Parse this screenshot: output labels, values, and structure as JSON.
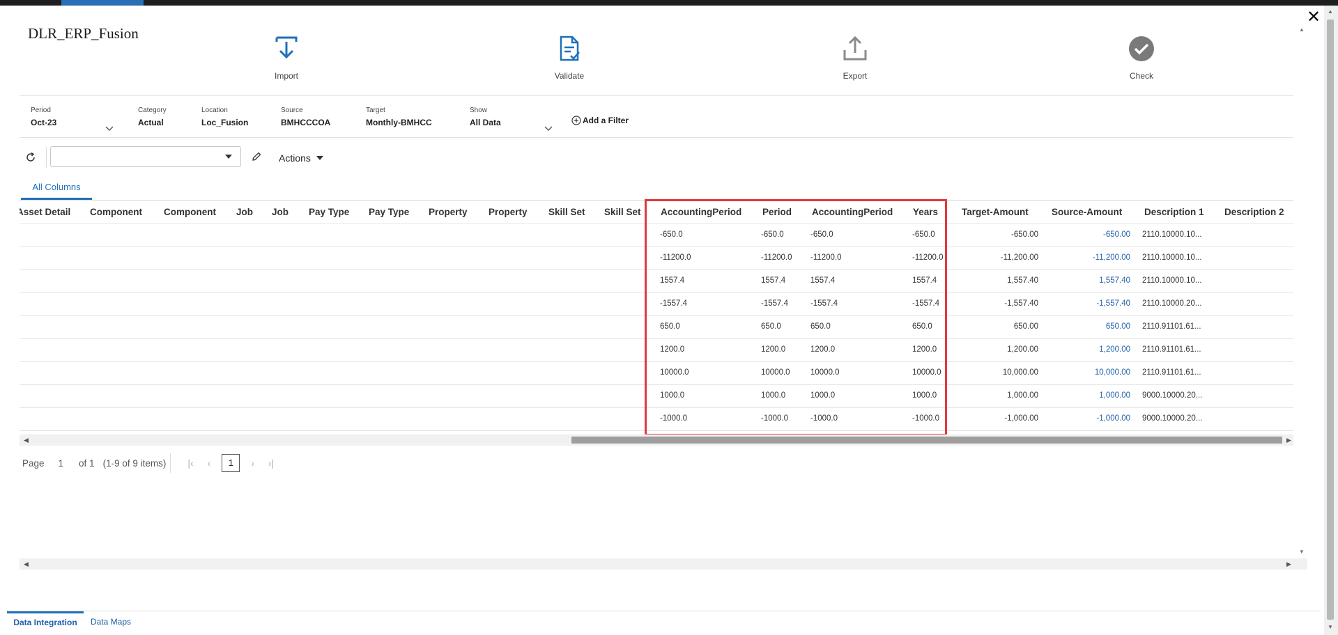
{
  "app": {
    "title": "DLR_ERP_Fusion"
  },
  "toolbar": {
    "import_label": "Import",
    "validate_label": "Validate",
    "export_label": "Export",
    "check_label": "Check"
  },
  "filters": {
    "period": {
      "label": "Period",
      "value": "Oct-23"
    },
    "category": {
      "label": "Category",
      "value": "Actual"
    },
    "location": {
      "label": "Location",
      "value": "Loc_Fusion"
    },
    "source": {
      "label": "Source",
      "value": "BMHCCCOA"
    },
    "target": {
      "label": "Target",
      "value": "Monthly-BMHCC"
    },
    "show": {
      "label": "Show",
      "value": "All Data"
    },
    "add_filter_label": "Add a Filter"
  },
  "grid_toolbar": {
    "view_value": "",
    "actions_label": "Actions"
  },
  "tabs": {
    "all_columns": "All Columns"
  },
  "columns": [
    "Asset Detail",
    "Component",
    "Component",
    "Job",
    "Job",
    "Pay Type",
    "Pay Type",
    "Property",
    "Property",
    "Skill Set",
    "Skill Set",
    "AccountingPeriod",
    "Period",
    "AccountingPeriod",
    "Years",
    "Target-Amount",
    "Source-Amount",
    "Description 1",
    "Description 2"
  ],
  "rows": [
    {
      "accounting_period": "-650.0",
      "period": "-650.0",
      "accounting_period_2": "-650.0",
      "years": "-650.0",
      "target_amount": "-650.00",
      "source_amount": "-650.00",
      "description_1": "2110.10000.10..."
    },
    {
      "accounting_period": "-11200.0",
      "period": "-11200.0",
      "accounting_period_2": "-11200.0",
      "years": "-11200.0",
      "target_amount": "-11,200.00",
      "source_amount": "-11,200.00",
      "description_1": "2110.10000.10..."
    },
    {
      "accounting_period": "1557.4",
      "period": "1557.4",
      "accounting_period_2": "1557.4",
      "years": "1557.4",
      "target_amount": "1,557.40",
      "source_amount": "1,557.40",
      "description_1": "2110.10000.10..."
    },
    {
      "accounting_period": "-1557.4",
      "period": "-1557.4",
      "accounting_period_2": "-1557.4",
      "years": "-1557.4",
      "target_amount": "-1,557.40",
      "source_amount": "-1,557.40",
      "description_1": "2110.10000.20..."
    },
    {
      "accounting_period": "650.0",
      "period": "650.0",
      "accounting_period_2": "650.0",
      "years": "650.0",
      "target_amount": "650.00",
      "source_amount": "650.00",
      "description_1": "2110.91101.61..."
    },
    {
      "accounting_period": "1200.0",
      "period": "1200.0",
      "accounting_period_2": "1200.0",
      "years": "1200.0",
      "target_amount": "1,200.00",
      "source_amount": "1,200.00",
      "description_1": "2110.91101.61..."
    },
    {
      "accounting_period": "10000.0",
      "period": "10000.0",
      "accounting_period_2": "10000.0",
      "years": "10000.0",
      "target_amount": "10,000.00",
      "source_amount": "10,000.00",
      "description_1": "2110.91101.61..."
    },
    {
      "accounting_period": "1000.0",
      "period": "1000.0",
      "accounting_period_2": "1000.0",
      "years": "1000.0",
      "target_amount": "1,000.00",
      "source_amount": "1,000.00",
      "description_1": "9000.10000.20..."
    },
    {
      "accounting_period": "-1000.0",
      "period": "-1000.0",
      "accounting_period_2": "-1000.0",
      "years": "-1000.0",
      "target_amount": "-1,000.00",
      "source_amount": "-1,000.00",
      "description_1": "9000.10000.20..."
    }
  ],
  "pagination": {
    "page_label": "Page",
    "page_value": "1",
    "of_label": "of 1",
    "items_label": "(1-9 of 9 items)",
    "current_page": "1"
  },
  "bottom_tabs": {
    "data_integration": "Data Integration",
    "data_maps": "Data Maps"
  },
  "colors": {
    "accent": "#1f6fb9",
    "highlight": "#e03a3a",
    "link": "#1f5fa8"
  }
}
